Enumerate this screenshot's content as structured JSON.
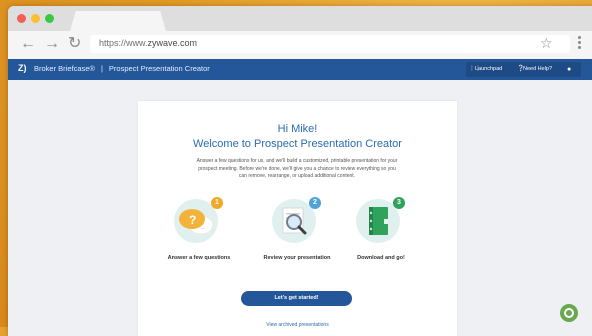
{
  "browser": {
    "url_prefix": "https://www.",
    "url_domain": "zywave.com",
    "icons": [
      "back-arrow-icon",
      "forward-arrow-icon",
      "reload-icon",
      "star-icon",
      "kebab-menu-icon"
    ]
  },
  "appbar": {
    "logo": "Z)",
    "product": "Broker Briefcase®",
    "separator": "|",
    "page": "Prospect Presentation Creator",
    "launchpad_label": "Launchpad",
    "help_label": "Need Help?",
    "color": "#24569a"
  },
  "main": {
    "greeting": "Hi Mike!",
    "title": "Welcome to Prospect Presentation Creator",
    "intro": "Answer a few questions for us, and we'll build a customized, printable presentation for your prospect meeting. Before we're done, we'll give you a chance to review everything so you can remove, rearrange, or upload additional content.",
    "steps": [
      {
        "number": "1",
        "label": "Answer a few questions",
        "icon": "speech-bubbles-icon",
        "badge_color": "#f0a928"
      },
      {
        "number": "2",
        "label": "Review your presentation",
        "icon": "magnifier-document-icon",
        "badge_color": "#4fa3d8"
      },
      {
        "number": "3",
        "label": "Download and go!",
        "icon": "binder-icon",
        "badge_color": "#2fa25b"
      }
    ],
    "cta_label": "Let's get started!",
    "archived_link": "View archived presentations"
  }
}
